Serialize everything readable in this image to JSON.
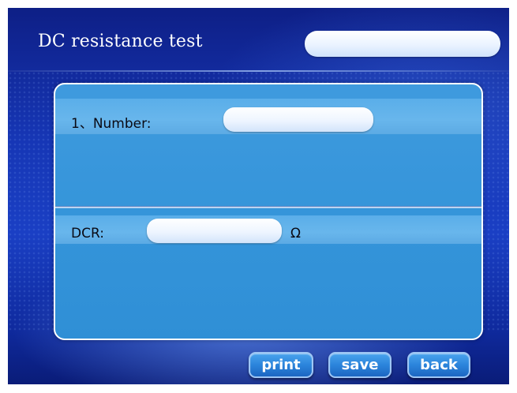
{
  "header": {
    "title": "DC resistance test",
    "search_value": ""
  },
  "form": {
    "number_label": "1、Number:",
    "number_value": "",
    "dcr_label": "DCR:",
    "dcr_value": "",
    "dcr_unit": "Ω"
  },
  "buttons": {
    "print": "print",
    "save": "save",
    "back": "back"
  },
  "colors": {
    "background": "#1636b5",
    "panel": "#3595da",
    "button": "#2b84db"
  }
}
